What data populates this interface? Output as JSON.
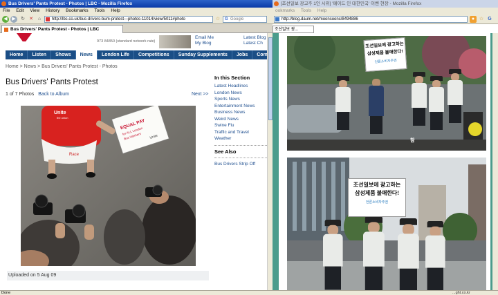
{
  "left_window": {
    "title": "Bus Drivers' Pants Protest - Photos | LBC - Mozilla Firefox",
    "menu": [
      "File",
      "Edit",
      "View",
      "History",
      "Bookmarks",
      "Tools",
      "Help"
    ],
    "url": "http://lbc.co.uk/bus-drivers-bum-protest---photos-11014/view/5011#photo",
    "search_placeholder": "Google",
    "tab_label": "Bus Drivers' Pants Protest - Photos | LBC",
    "status": "Done"
  },
  "lbc": {
    "top_links_left": [
      "Email Me",
      "My Blog"
    ],
    "top_links_right": [
      "Latest Blog",
      "Latest Ch"
    ],
    "phone": "973 84850 (standard network rate)",
    "nav": [
      "Home",
      "Listen",
      "Shows",
      "News",
      "London Life",
      "Competitions",
      "Sunday Supplements",
      "Jobs",
      "Com"
    ],
    "nav_active": "News",
    "breadcrumb": "Home  >  News  >  Bus Drivers' Pants Protest - Photos",
    "headline": "Bus Drivers' Pants Protest",
    "photo_count": "1 of 7 Photos",
    "back_link": "Back to Album",
    "next_link": "Next >>",
    "uploaded": "Uploaded on 5 Aug 09",
    "photo": {
      "placard_line1": "EQUAL PAY",
      "placard_line2": "for ALL London",
      "placard_line3": "Bus Workers",
      "placard_logo": "Unite",
      "shirt_logo": "Unite",
      "shirt_logo_sub": "the union",
      "shorts_text": "Race"
    },
    "sidebar": {
      "section_title": "In this Section",
      "links": [
        "Latest Headlines",
        "London News",
        "Sports News",
        "Entertainment News",
        "Business News",
        "Weird News",
        "Swine Flu",
        "Traffic and Travel",
        "Weather"
      ],
      "see_also_title": "See Also",
      "see_also_links": [
        "Bus Drivers Strip Off"
      ]
    }
  },
  "right_window": {
    "title": "[조선일보 광고주 1인 시위] '메이드 인 대한민국' 이벤 현장 - Mozilla Firefox",
    "menu": [
      "ookmarks",
      "Tools",
      "Help"
    ],
    "url": "http://blog.daum.net/moonsoonc/8494886",
    "tab_label": "조선일보 광...",
    "status": "...ght.co.kr"
  },
  "daum": {
    "sign1_line1": "조선일보에 광고하는",
    "sign1_line2": "삼성제품 불매한다!",
    "sign1_logo": "언론소비자주권",
    "sign2_line1": "조선일보에 광고하는",
    "sign2_line2": "삼성제품 불매한다!",
    "sign2_logo": "언론소비자주권",
    "sign_small": "참"
  }
}
